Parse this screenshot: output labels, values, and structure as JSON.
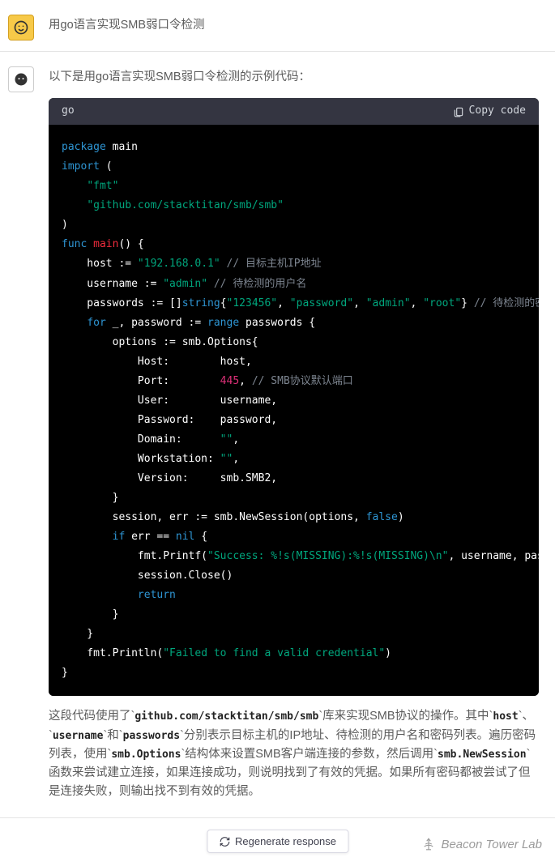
{
  "user_message": "用go语言实现SMB弱口令检测",
  "assistant_intro": "以下是用go语言实现SMB弱口令检测的示例代码：",
  "code_lang": "go",
  "copy_label": "Copy code",
  "regenerate_label": "Regenerate response",
  "watermark": "Beacon Tower Lab",
  "code": {
    "l1_package": "package",
    "l1_main": " main",
    "l2_import": "import",
    "l2_paren": " (",
    "l3_fmt": "\"fmt\"",
    "l4_smb": "\"github.com/stacktitan/smb/smb\"",
    "l5_close": ")",
    "l6_func": "func",
    "l6_main": "main",
    "l6_rest": "() {",
    "l7_pre": "    host := ",
    "l7_str": "\"192.168.0.1\"",
    "l7_cmt": " // 目标主机IP地址",
    "l8_pre": "    username := ",
    "l8_str": "\"admin\"",
    "l8_cmt": " // 待检测的用户名",
    "l9_pre": "    passwords := []",
    "l9_type": "string",
    "l9_brace": "{",
    "l9_s1": "\"123456\"",
    "l9_c1": ", ",
    "l9_s2": "\"password\"",
    "l9_c2": ", ",
    "l9_s3": "\"admin\"",
    "l9_c3": ", ",
    "l9_s4": "\"root\"",
    "l9_end": "} ",
    "l9_cmt": "// 待检测的密",
    "l10_pre": "    ",
    "l10_for": "for",
    "l10_mid": " _, password := ",
    "l10_range": "range",
    "l10_end": " passwords {",
    "l11": "        options := smb.Options{",
    "l12": "            Host:        host,",
    "l13_pre": "            Port:        ",
    "l13_num": "445",
    "l13_c": ", ",
    "l13_cmt": "// SMB协议默认端口",
    "l14": "            User:        username,",
    "l15": "            Password:    password,",
    "l16_pre": "            Domain:      ",
    "l16_str": "\"\"",
    "l16_end": ",",
    "l17_pre": "            Workstation: ",
    "l17_str": "\"\"",
    "l17_end": ",",
    "l18": "            Version:     smb.SMB2,",
    "l19": "        }",
    "l20_pre": "        session, err := smb.NewSession(options, ",
    "l20_false": "false",
    "l20_end": ")",
    "l21_pre": "        ",
    "l21_if": "if",
    "l21_mid": " err == ",
    "l21_nil": "nil",
    "l21_end": " {",
    "l22_pre": "            fmt.Printf(",
    "l22_str": "\"Success: %!s(MISSING):%!s(MISSING)\\n\"",
    "l22_end": ", username, pas",
    "l23": "            session.Close()",
    "l24_pre": "            ",
    "l24_ret": "return",
    "l25": "        }",
    "l26": "    }",
    "l27_pre": "    fmt.Println(",
    "l27_str": "\"Failed to find a valid credential\"",
    "l27_end": ")",
    "l28": "}"
  },
  "explain": {
    "p1a": "这段代码使用了`",
    "p1_code1": "github.com/stacktitan/smb/smb",
    "p1b": "`库来实现SMB协议的操作。其中`",
    "p1_code2": "host",
    "p1c": "`、`",
    "p1_code3": "username",
    "p1d": "`和`",
    "p1_code4": "passwords",
    "p1e": "`分别表示目标主机的IP地址、待检测的用户名和密码列表。遍历密码列表，使用`",
    "p1_code5": "smb.Options",
    "p1f": "`结构体来设置SMB客户端连接的参数，然后调用`",
    "p1_code6": "smb.NewSession",
    "p1g": "`函数来尝试建立连接，如果连接成功，则说明找到了有效的凭据。如果所有密码都被尝试了但是连接失败，则输出找不到有效的凭据。"
  }
}
